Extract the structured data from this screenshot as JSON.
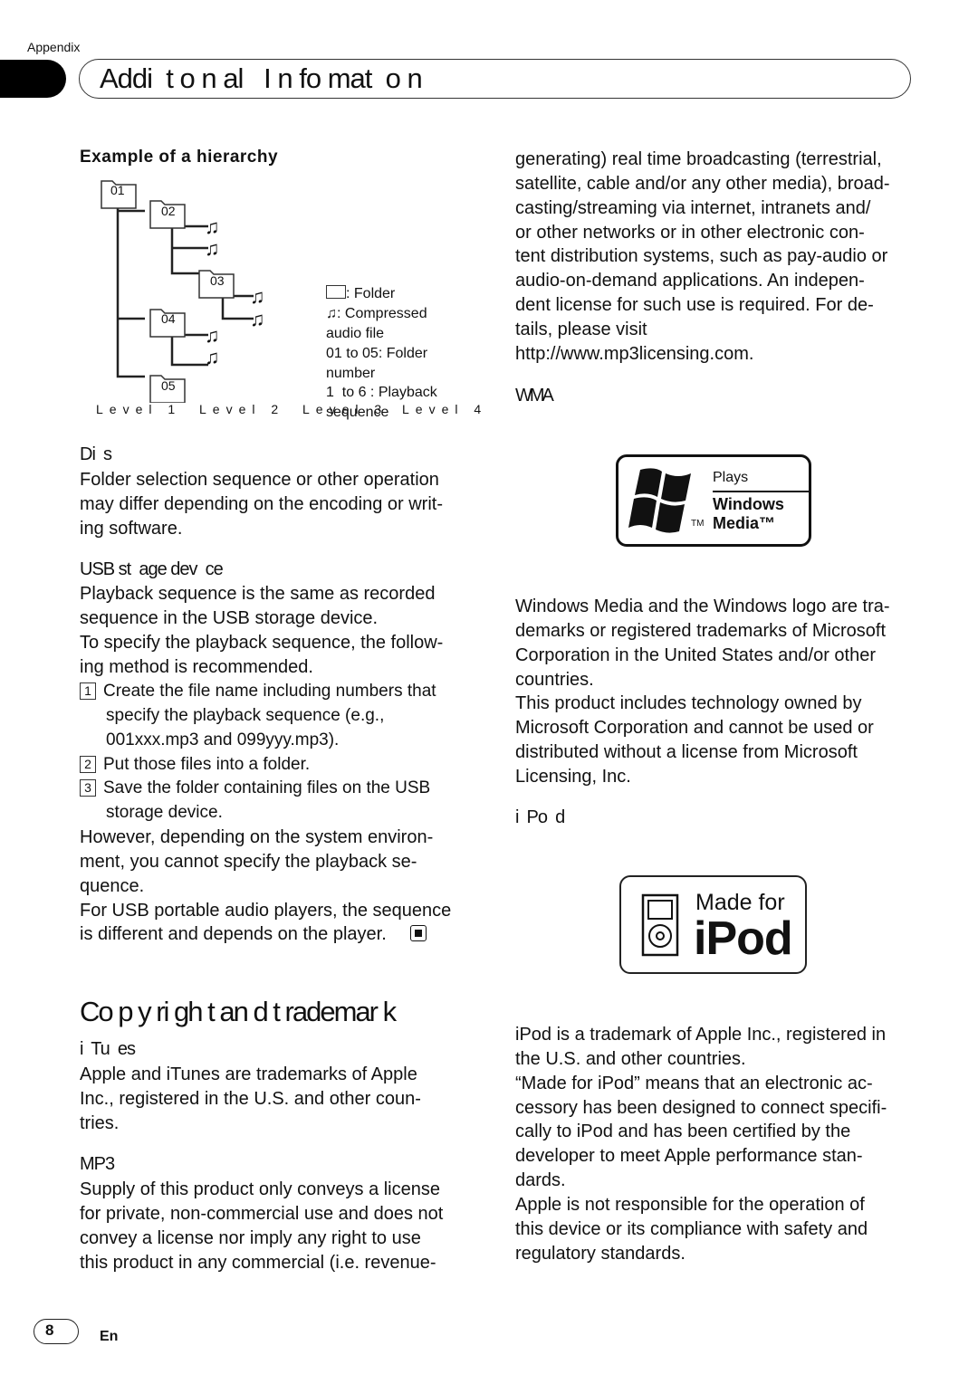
{
  "header": {
    "section": "Appendix",
    "title": "Addi  t o n al   I n fo mat  o n"
  },
  "hierarchy": {
    "title": "Example of a hierarchy",
    "folders": [
      "01",
      "02",
      "03",
      "04",
      "05"
    ],
    "levels": [
      "Level 1",
      "Level 2",
      "Level 3",
      "Level 4"
    ],
    "legend": {
      "folder": ": Folder",
      "audio": [
        ": Compressed",
        "audio file"
      ],
      "numbers": [
        "01 to 05: Folder",
        "number"
      ],
      "sequence": [
        "1  to 6 : Playback",
        "sequence"
      ]
    }
  },
  "left": {
    "discs": {
      "heading": "Di  s",
      "lines": [
        "Folder selection sequence or other operation",
        "may differ depending on the encoding or writ-",
        "ing software."
      ]
    },
    "usb": {
      "heading": "USB st  age dev  ce",
      "lines": [
        "Playback sequence is the same as recorded",
        "sequence in the USB storage device.",
        "To specify the playback sequence, the follow-",
        "ing method is recommended."
      ],
      "steps": [
        {
          "n": "1",
          "lines": [
            "Create the file name including numbers that",
            "specify the playback sequence (e.g.,",
            "001xxx.mp3 and 099yyy.mp3)."
          ]
        },
        {
          "n": "2",
          "lines": [
            "Put those files into a folder."
          ]
        },
        {
          "n": "3",
          "lines": [
            "Save the folder containing files on the USB",
            "storage device."
          ]
        }
      ],
      "after": [
        "However, depending on the system environ-",
        "ment, you cannot specify the playback se-",
        "quence.",
        "For USB portable audio players, the sequence",
        "is different and depends on the player."
      ]
    },
    "section_title": "Co p y ri gh t an d t rademar k",
    "itunes": {
      "heading": "i  Tu  es",
      "lines": [
        "Apple and iTunes are trademarks of Apple",
        "Inc., registered in the U.S. and other coun-",
        "tries."
      ]
    },
    "mp3": {
      "heading": "MP3",
      "lines": [
        "Supply of this product only conveys a license",
        "for private, non-commercial use and does not",
        "convey a license nor imply any right to use",
        "this product in any commercial (i.e. revenue-"
      ]
    }
  },
  "right": {
    "mp3_cont": [
      "generating) real time broadcasting (terrestrial,",
      "satellite, cable and/or any other media), broad-",
      "casting/streaming via internet, intranets and/",
      "or other networks or in other electronic con-",
      "tent distribution systems, such as pay-audio or",
      "audio-on-demand applications. An indepen-",
      "dent license for such use is required. For de-",
      "tails, please visit",
      "http://www.mp3licensing.com."
    ],
    "wma": {
      "heading": "WMA",
      "logo": {
        "plays": "Plays",
        "windows": "Windows",
        "media": "Media™",
        "tm": "TM"
      },
      "lines": [
        "Windows Media and the Windows logo are tra-",
        "demarks or registered trademarks of Microsoft",
        "Corporation in the United States and/or other",
        "countries.",
        "This product includes technology owned by",
        "Microsoft Corporation and cannot be used or",
        "distributed without a license from Microsoft",
        "Licensing, Inc."
      ]
    },
    "ipod": {
      "heading": "i  Po  d",
      "logo": {
        "made_for": "Made for",
        "ipod": "iPod"
      },
      "lines": [
        "iPod is a trademark of Apple Inc., registered in",
        "the U.S. and other countries.",
        "“Made for iPod” means that an electronic ac-",
        "cessory has been designed to connect specifi-",
        "cally to iPod and has been certified by the",
        "developer to meet Apple performance stan-",
        "dards.",
        "Apple is not responsible for the operation of",
        "this device or its compliance with safety and",
        "regulatory standards."
      ]
    }
  },
  "footer": {
    "page": "8",
    "lang": "En"
  }
}
